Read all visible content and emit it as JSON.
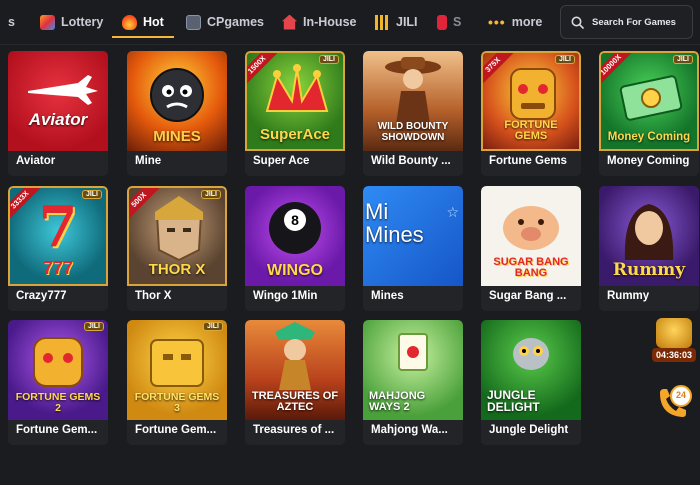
{
  "nav": {
    "tabs": [
      {
        "label": "s",
        "icon": "partial-tab-icon"
      },
      {
        "label": "Lottery",
        "icon": "lottery-icon"
      },
      {
        "label": "Hot",
        "icon": "fire-icon",
        "active": true
      },
      {
        "label": "CPgames",
        "icon": "cpgames-icon"
      },
      {
        "label": "In-House",
        "icon": "home-icon"
      },
      {
        "label": "JILI",
        "icon": "jili-icon"
      },
      {
        "label": "S",
        "icon": "slots-icon"
      },
      {
        "label": "more",
        "icon": "more-dots-icon"
      }
    ],
    "search_placeholder": "Search For Games"
  },
  "games": [
    {
      "name": "Aviator",
      "art": "Aviator"
    },
    {
      "name": "Mine",
      "art": "MINES"
    },
    {
      "name": "Super Ace",
      "art": "SuperAce",
      "ribbon": "1500X",
      "tag": "JILI"
    },
    {
      "name": "Wild Bounty ...",
      "art": "WILD BOUNTY SHOWDOWN"
    },
    {
      "name": "Fortune Gems",
      "art": "FORTUNE GEMS",
      "ribbon": "375X",
      "tag": "JILI"
    },
    {
      "name": "Money Coming",
      "art": "Money Coming",
      "ribbon": "10000X",
      "tag": "JILI"
    },
    {
      "name": "Crazy777",
      "art": "777",
      "ribbon": "3333X",
      "tag": "JILI"
    },
    {
      "name": "Thor X",
      "art": "THOR X",
      "ribbon": "500X",
      "tag": "JILI"
    },
    {
      "name": "Wingo 1Min",
      "art": "WINGO"
    },
    {
      "name": "Mines",
      "art": "Mi Mines"
    },
    {
      "name": "Sugar Bang ...",
      "art": "SUGAR BANG BANG"
    },
    {
      "name": "Rummy",
      "art": "Rummy"
    },
    {
      "name": "Fortune Gem...",
      "art": "FORTUNE GEMS 2",
      "tag": "JILI"
    },
    {
      "name": "Fortune Gem...",
      "art": "FORTUNE GEMS 3",
      "tag": "JILI"
    },
    {
      "name": "Treasures of ...",
      "art": "TREASURES OF AZTEC"
    },
    {
      "name": "Mahjong Wa...",
      "art": "MAHJONG WAYS 2"
    },
    {
      "name": "Jungle Delight",
      "art": "JUNGLE DELIGHT"
    }
  ],
  "widgets": {
    "timer": "04:36:03",
    "support_label": "24"
  }
}
